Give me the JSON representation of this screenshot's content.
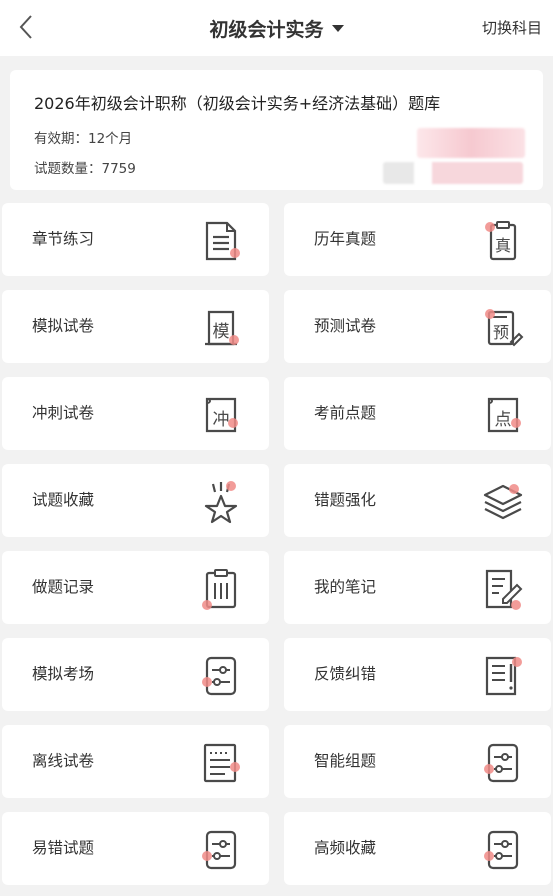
{
  "header": {
    "title": "初级会计实务",
    "switch_label": "切换科目"
  },
  "bank": {
    "title": "2026年初级会计职称（初级会计实务+经济法基础）题库",
    "validity": "有效期：12个月",
    "count": "试题数量：7759"
  },
  "menu": {
    "items": [
      {
        "label": "章节练习",
        "icon": "document-icon"
      },
      {
        "label": "历年真题",
        "icon": "past-exam-icon"
      },
      {
        "label": "模拟试卷",
        "icon": "mock-paper-icon"
      },
      {
        "label": "预测试卷",
        "icon": "forecast-paper-icon"
      },
      {
        "label": "冲刺试卷",
        "icon": "sprint-paper-icon"
      },
      {
        "label": "考前点题",
        "icon": "key-points-icon"
      },
      {
        "label": "试题收藏",
        "icon": "star-icon"
      },
      {
        "label": "错题强化",
        "icon": "layers-icon"
      },
      {
        "label": "做题记录",
        "icon": "clipboard-icon"
      },
      {
        "label": "我的笔记",
        "icon": "note-edit-icon"
      },
      {
        "label": "模拟考场",
        "icon": "sliders-icon"
      },
      {
        "label": "反馈纠错",
        "icon": "feedback-icon"
      },
      {
        "label": "离线试卷",
        "icon": "offline-paper-icon"
      },
      {
        "label": "智能组题",
        "icon": "sliders-icon"
      },
      {
        "label": "易错试题",
        "icon": "sliders-icon"
      },
      {
        "label": "高频收藏",
        "icon": "sliders-icon"
      }
    ]
  },
  "colors": {
    "icon_stroke": "#4a4a4a",
    "accent_dot": "#f08b87",
    "background": "#f2f2f2"
  }
}
